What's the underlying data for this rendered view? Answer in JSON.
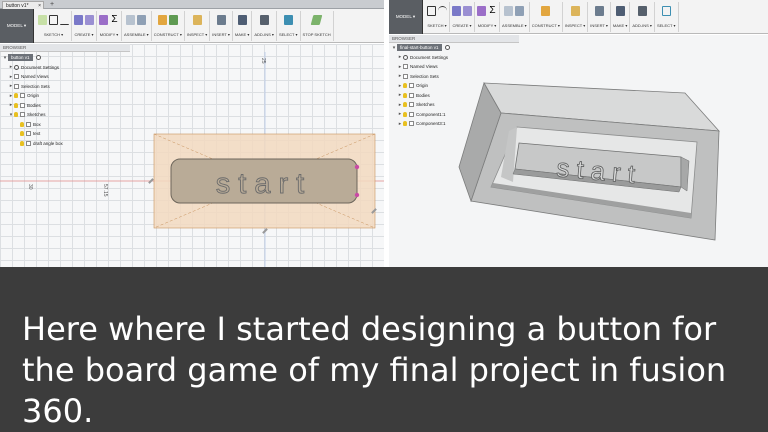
{
  "left_window": {
    "tab_title": "button v1*",
    "tab_close": "×",
    "tab_add": "+",
    "model_button": "MODEL ▾",
    "toolbar_groups": [
      "SKETCH ▾",
      "CREATE ▾",
      "MODIFY ▾",
      "ASSEMBLE ▾",
      "CONSTRUCT ▾",
      "INSPECT ▾",
      "INSERT ▾",
      "MAKE ▾",
      "ADD-INS ▾",
      "SELECT ▾",
      "STOP SKETCH"
    ],
    "browser_label": "BROWSER",
    "tree": [
      {
        "label": "button v1",
        "level": 0,
        "kind": "root"
      },
      {
        "label": "Document Settings",
        "level": 1,
        "kind": "gear"
      },
      {
        "label": "Named Views",
        "level": 1,
        "kind": "folder"
      },
      {
        "label": "Selection Sets",
        "level": 1,
        "kind": "folder"
      },
      {
        "label": "Origin",
        "level": 1,
        "kind": "bulb"
      },
      {
        "label": "Bodies",
        "level": 1,
        "kind": "bulb"
      },
      {
        "label": "Sketches",
        "level": 1,
        "kind": "bulb"
      },
      {
        "label": "Box",
        "level": 2,
        "kind": "bulb"
      },
      {
        "label": "text",
        "level": 2,
        "kind": "bulb"
      },
      {
        "label": "draft angle box",
        "level": 2,
        "kind": "bulb"
      }
    ],
    "button_text": "start",
    "dimension_labels": [
      "30",
      "57.15",
      "25"
    ]
  },
  "right_window": {
    "model_button": "MODEL ▾",
    "toolbar_groups": [
      "SKETCH ▾",
      "CREATE ▾",
      "MODIFY ▾",
      "ASSEMBLE ▾",
      "CONSTRUCT ▾",
      "INSPECT ▾",
      "INSERT ▾",
      "MAKE ▾",
      "ADD-INS ▾",
      "SELECT ▾"
    ],
    "browser_label": "BROWSER",
    "tree": [
      {
        "label": "final-start-button v1",
        "level": 0,
        "kind": "root"
      },
      {
        "label": "Document Settings",
        "level": 1,
        "kind": "gear"
      },
      {
        "label": "Named Views",
        "level": 1,
        "kind": "folder"
      },
      {
        "label": "Selection Sets",
        "level": 1,
        "kind": "folder"
      },
      {
        "label": "Origin",
        "level": 1,
        "kind": "bulb"
      },
      {
        "label": "Bodies",
        "level": 1,
        "kind": "bulb"
      },
      {
        "label": "Sketches",
        "level": 1,
        "kind": "bulb"
      },
      {
        "label": "Component1:1",
        "level": 1,
        "kind": "bulb"
      },
      {
        "label": "Component3:1",
        "level": 1,
        "kind": "bulb"
      }
    ],
    "button_text": "start"
  },
  "caption": "Here where I started designing a button for the board game of my final project in fusion 360.",
  "colors": {
    "caption_bg": "#3c3c3c",
    "caption_fg": "#ffffff",
    "sketch_fill": "#b9ab97",
    "selection_fill": "#f2d9c0",
    "frame_gray": "#bfc0c0"
  }
}
